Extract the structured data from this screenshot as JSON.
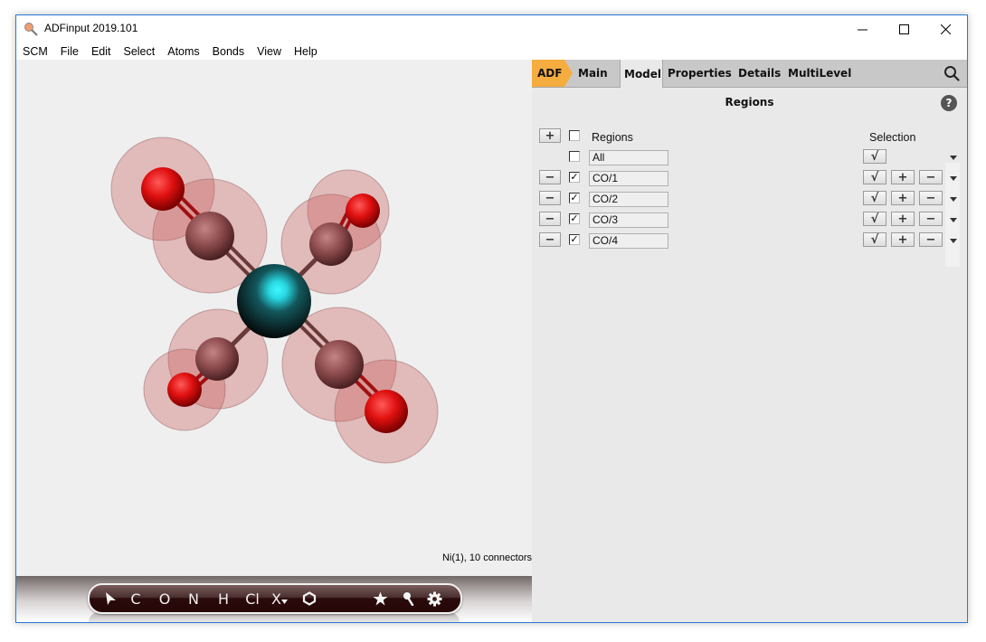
{
  "window": {
    "title": "ADFinput 2019.101",
    "controls": {
      "minimize": "minimize",
      "maximize": "maximize",
      "close": "close"
    }
  },
  "menubar": {
    "items": [
      "SCM",
      "File",
      "Edit",
      "Select",
      "Atoms",
      "Bonds",
      "View",
      "Help"
    ]
  },
  "viewport": {
    "status": "Ni(1), 10 connectors",
    "molecule": {
      "center_atom": "Ni",
      "ligands": [
        "CO/1",
        "CO/2",
        "CO/3",
        "CO/4"
      ],
      "colors": {
        "nickel": "#1fb9c4",
        "carbon": "#8a4a4c",
        "oxygen": "#e01010",
        "region_halo": "#d46a6a"
      }
    }
  },
  "toolbar": {
    "items": [
      {
        "id": "select",
        "label": "",
        "icon": "cursor-arrow-icon"
      },
      {
        "id": "C",
        "label": "C"
      },
      {
        "id": "O",
        "label": "O"
      },
      {
        "id": "N",
        "label": "N"
      },
      {
        "id": "H",
        "label": "H"
      },
      {
        "id": "Cl",
        "label": "Cl"
      },
      {
        "id": "X",
        "label": "X"
      },
      {
        "id": "ring",
        "label": "",
        "icon": "hexagon-ring-icon"
      },
      {
        "id": "star",
        "label": "★",
        "icon": "star-icon"
      },
      {
        "id": "pin",
        "label": "",
        "icon": "pin-icon"
      },
      {
        "id": "gear",
        "label": "",
        "icon": "gear-icon"
      }
    ]
  },
  "panel": {
    "tabs": [
      "ADF",
      "Main",
      "Model",
      "Properties",
      "Details",
      "MultiLevel"
    ],
    "active_tab": "Model",
    "accent": "#f5ad3f",
    "section_title": "Regions",
    "help_label": "?",
    "columns": {
      "regions": "Regions",
      "selection": "Selection"
    },
    "add_label": "+",
    "remove_label": "−",
    "select_label": "√",
    "plus_label": "+",
    "minus_label": "−",
    "header_checked": false,
    "rows": [
      {
        "name": "All",
        "checked": false,
        "removable": false
      },
      {
        "name": "CO/1",
        "checked": true,
        "removable": true
      },
      {
        "name": "CO/2",
        "checked": true,
        "removable": true
      },
      {
        "name": "CO/3",
        "checked": true,
        "removable": true
      },
      {
        "name": "CO/4",
        "checked": true,
        "removable": true
      }
    ]
  }
}
